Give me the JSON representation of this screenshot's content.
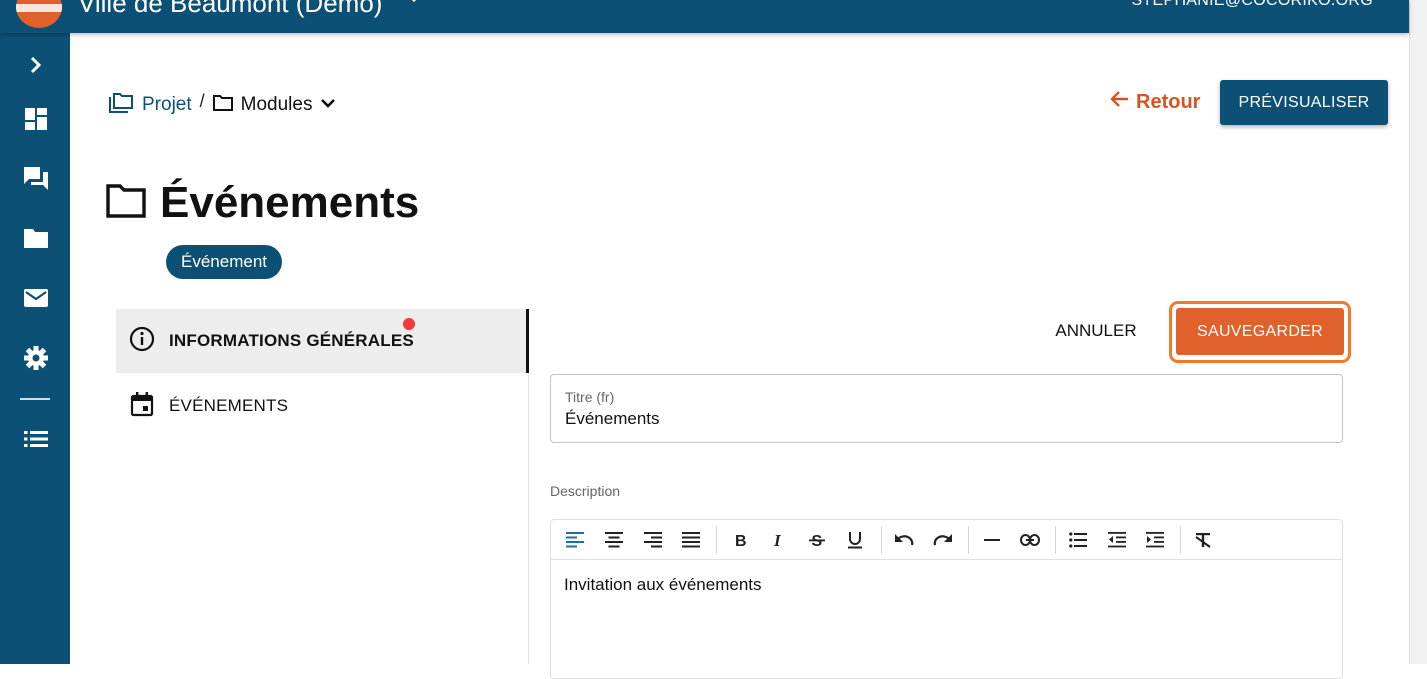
{
  "header": {
    "app_title": "Ville de Beaumont (Demo)",
    "user_email": "STEPHANIE@COCORIKO.ORG",
    "brand_color": "#0c5075"
  },
  "sidebar": {
    "items": [
      {
        "icon": "chevron-right-icon"
      },
      {
        "icon": "dashboard-icon"
      },
      {
        "icon": "forum-icon"
      },
      {
        "icon": "folder-icon"
      },
      {
        "icon": "mail-icon"
      },
      {
        "icon": "settings-icon"
      },
      {
        "icon": "list-icon"
      }
    ]
  },
  "breadcrumb": {
    "root": "Projet",
    "separator": "/",
    "current": "Modules"
  },
  "actions": {
    "back_label": "Retour",
    "preview_label": "PRÉVISUALISER"
  },
  "page": {
    "title": "Événements",
    "chip": "Événement"
  },
  "tabs": [
    {
      "label": "INFORMATIONS GÉNÉRALES",
      "active": true,
      "has_error_dot": true
    },
    {
      "label": "ÉVÉNEMENTS",
      "active": false
    }
  ],
  "form": {
    "cancel_label": "ANNULER",
    "save_label": "SAUVEGARDER",
    "title_field": {
      "label": "Titre (fr)",
      "value": "Événements"
    },
    "description_label": "Description",
    "description_text": "Invitation aux événements"
  },
  "colors": {
    "accent_orange": "#e0612b",
    "link_orange": "#d9531e",
    "error_dot": "#f23a3a"
  }
}
